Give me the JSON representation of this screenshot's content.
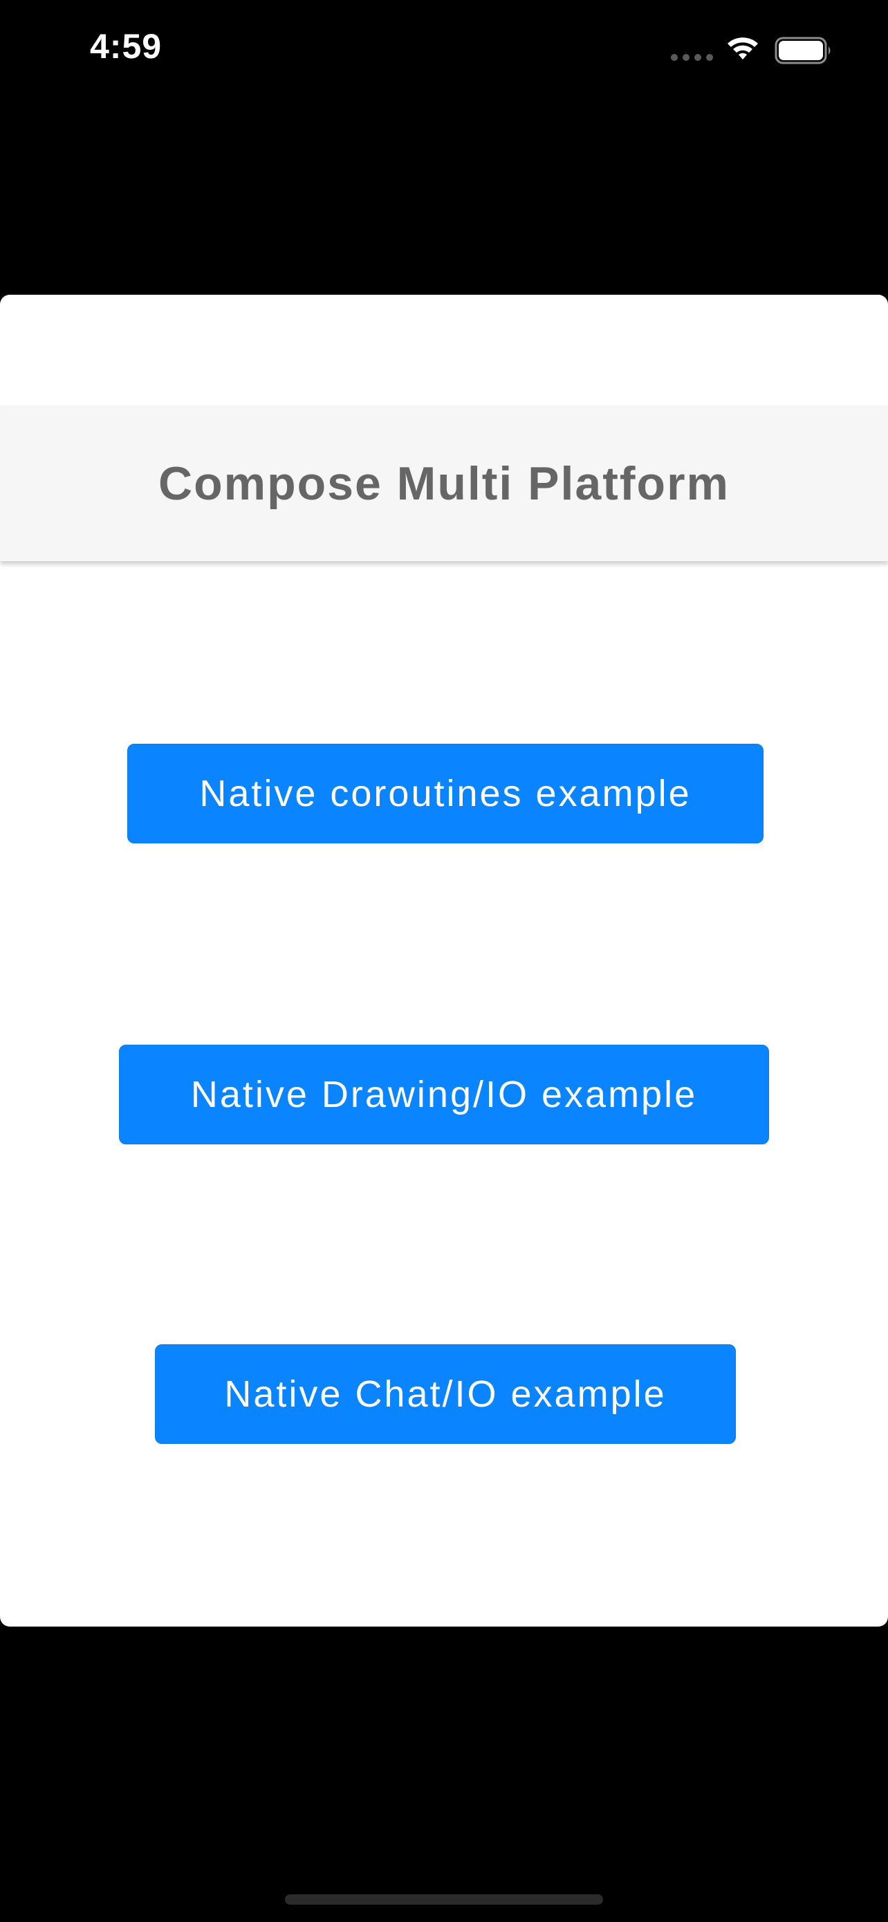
{
  "status_bar": {
    "time": "4:59",
    "icons": [
      "signal-dots-icon",
      "wifi-icon",
      "battery-icon"
    ]
  },
  "app_bar": {
    "title": "Compose Multi Platform"
  },
  "buttons": [
    {
      "label": "Native coroutines example"
    },
    {
      "label": "Native Drawing/IO example"
    },
    {
      "label": "Native Chat/IO example"
    }
  ],
  "colors": {
    "background": "#000000",
    "card": "#ffffff",
    "app_bar": "#f6f6f6",
    "title_text": "#666666",
    "button": "#0a84ff",
    "button_text": "#ffffff"
  }
}
